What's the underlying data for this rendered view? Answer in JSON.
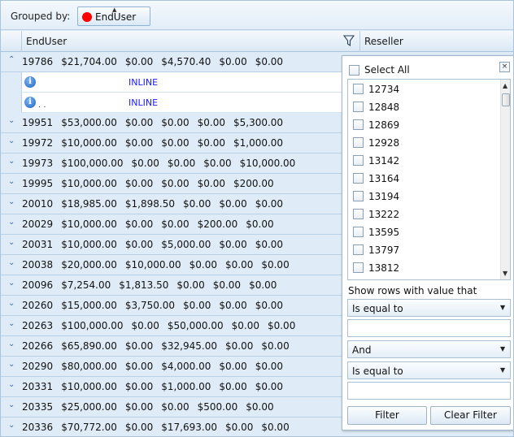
{
  "group_panel": {
    "label": "Grouped by:",
    "chip": "EndUser"
  },
  "header": {
    "col_enduser": "EndUser",
    "col_reseller": "Reseller"
  },
  "detail": {
    "inline": "INLINE",
    "dots": ". ."
  },
  "rows": [
    {
      "id": "19786",
      "vals": [
        "$21,704.00",
        "$0.00",
        "$4,570.40",
        "$0.00",
        "$0.00"
      ],
      "expanded": true
    },
    {
      "id": "19951",
      "vals": [
        "$53,000.00",
        "$0.00",
        "$0.00",
        "$0.00",
        "$5,300.00"
      ]
    },
    {
      "id": "19972",
      "vals": [
        "$10,000.00",
        "$0.00",
        "$0.00",
        "$0.00",
        "$1,000.00"
      ]
    },
    {
      "id": "19973",
      "vals": [
        "$100,000.00",
        "$0.00",
        "$0.00",
        "$0.00",
        "$10,000.00"
      ]
    },
    {
      "id": "19995",
      "vals": [
        "$10,000.00",
        "$0.00",
        "$0.00",
        "$0.00",
        "$200.00"
      ]
    },
    {
      "id": "20010",
      "vals": [
        "$18,985.00",
        "$1,898.50",
        "$0.00",
        "$0.00",
        "$0.00"
      ]
    },
    {
      "id": "20029",
      "vals": [
        "$10,000.00",
        "$0.00",
        "$0.00",
        "$200.00",
        "$0.00"
      ]
    },
    {
      "id": "20031",
      "vals": [
        "$10,000.00",
        "$0.00",
        "$5,000.00",
        "$0.00",
        "$0.00"
      ]
    },
    {
      "id": "20038",
      "vals": [
        "$20,000.00",
        "$10,000.00",
        "$0.00",
        "$0.00",
        "$0.00"
      ]
    },
    {
      "id": "20096",
      "vals": [
        "$7,254.00",
        "$1,813.50",
        "$0.00",
        "$0.00",
        "$0.00"
      ]
    },
    {
      "id": "20260",
      "vals": [
        "$15,000.00",
        "$3,750.00",
        "$0.00",
        "$0.00",
        "$0.00"
      ]
    },
    {
      "id": "20263",
      "vals": [
        "$100,000.00",
        "$0.00",
        "$50,000.00",
        "$0.00",
        "$0.00"
      ]
    },
    {
      "id": "20266",
      "vals": [
        "$65,890.00",
        "$0.00",
        "$32,945.00",
        "$0.00",
        "$0.00"
      ]
    },
    {
      "id": "20290",
      "vals": [
        "$80,000.00",
        "$0.00",
        "$4,000.00",
        "$0.00",
        "$0.00"
      ]
    },
    {
      "id": "20331",
      "vals": [
        "$10,000.00",
        "$0.00",
        "$1,000.00",
        "$0.00",
        "$0.00"
      ]
    },
    {
      "id": "20335",
      "vals": [
        "$25,000.00",
        "$0.00",
        "$0.00",
        "$500.00",
        "$0.00"
      ]
    },
    {
      "id": "20336",
      "vals": [
        "$70,772.00",
        "$0.00",
        "$17,693.00",
        "$0.00",
        "$0.00"
      ]
    }
  ],
  "filter": {
    "select_all": "Select All",
    "close": "×",
    "items": [
      "12734",
      "12848",
      "12869",
      "12928",
      "13142",
      "13164",
      "13194",
      "13222",
      "13595",
      "13797",
      "13812"
    ],
    "show_rows": "Show rows with value that",
    "op1": "Is equal to",
    "logic": "And",
    "op2": "Is equal to",
    "filter_btn": "Filter",
    "clear_btn": "Clear Filter"
  },
  "icons": {
    "chevron_up": "⌃",
    "chevron_down": "⌄",
    "filter": "filter-icon",
    "info": "i",
    "scroll_up": "▲",
    "scroll_down": "▼",
    "dropdown": "▼"
  },
  "colors": {
    "group_row_bg": "#dfecf7",
    "inline_text": "#1a1aff",
    "chip_dot": "#ff0000"
  }
}
